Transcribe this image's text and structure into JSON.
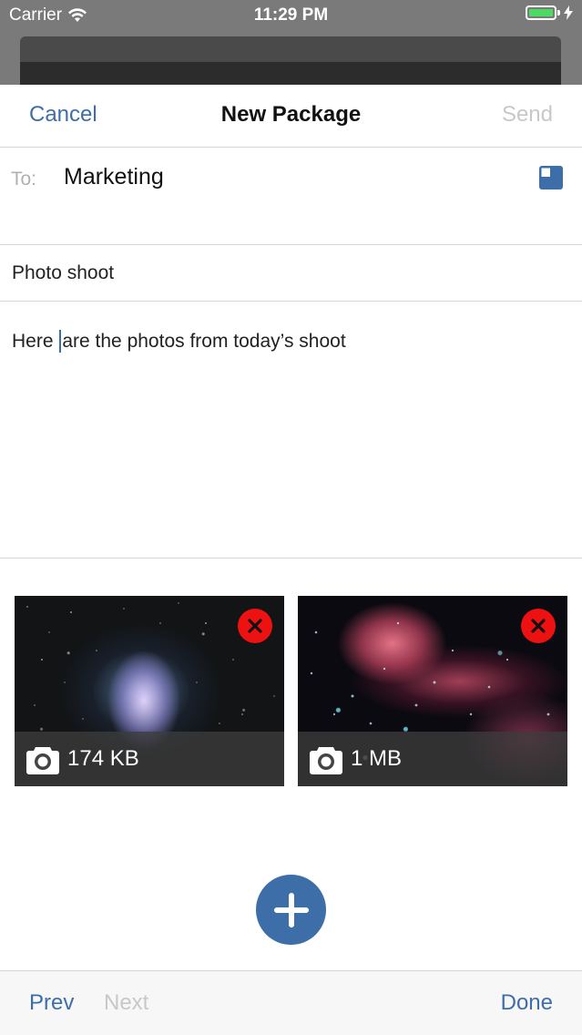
{
  "status_bar": {
    "carrier": "Carrier",
    "time": "11:29 PM",
    "battery_level": 1.0,
    "battery_color": "#4cd964"
  },
  "nav": {
    "cancel_label": "Cancel",
    "title": "New Package",
    "send_label": "Send"
  },
  "compose": {
    "to_label": "To:",
    "to_value": "Marketing",
    "contact_icon": "contact-picker-icon",
    "subject": "Photo shoot",
    "body_before_cursor": "Here ",
    "body_after_cursor": "are the photos from today’s shoot"
  },
  "attachments": [
    {
      "size": "174 KB",
      "icon": "camera-icon",
      "remove_icon": "remove-icon"
    },
    {
      "size": "1 MB",
      "icon": "camera-icon",
      "remove_icon": "remove-icon"
    }
  ],
  "add_button": {
    "icon": "plus-icon"
  },
  "toolbar": {
    "prev_label": "Prev",
    "next_label": "Next",
    "done_label": "Done"
  },
  "colors": {
    "accent": "#3d6ea8",
    "disabled": "#c8c8c8",
    "remove": "#ee1111"
  }
}
